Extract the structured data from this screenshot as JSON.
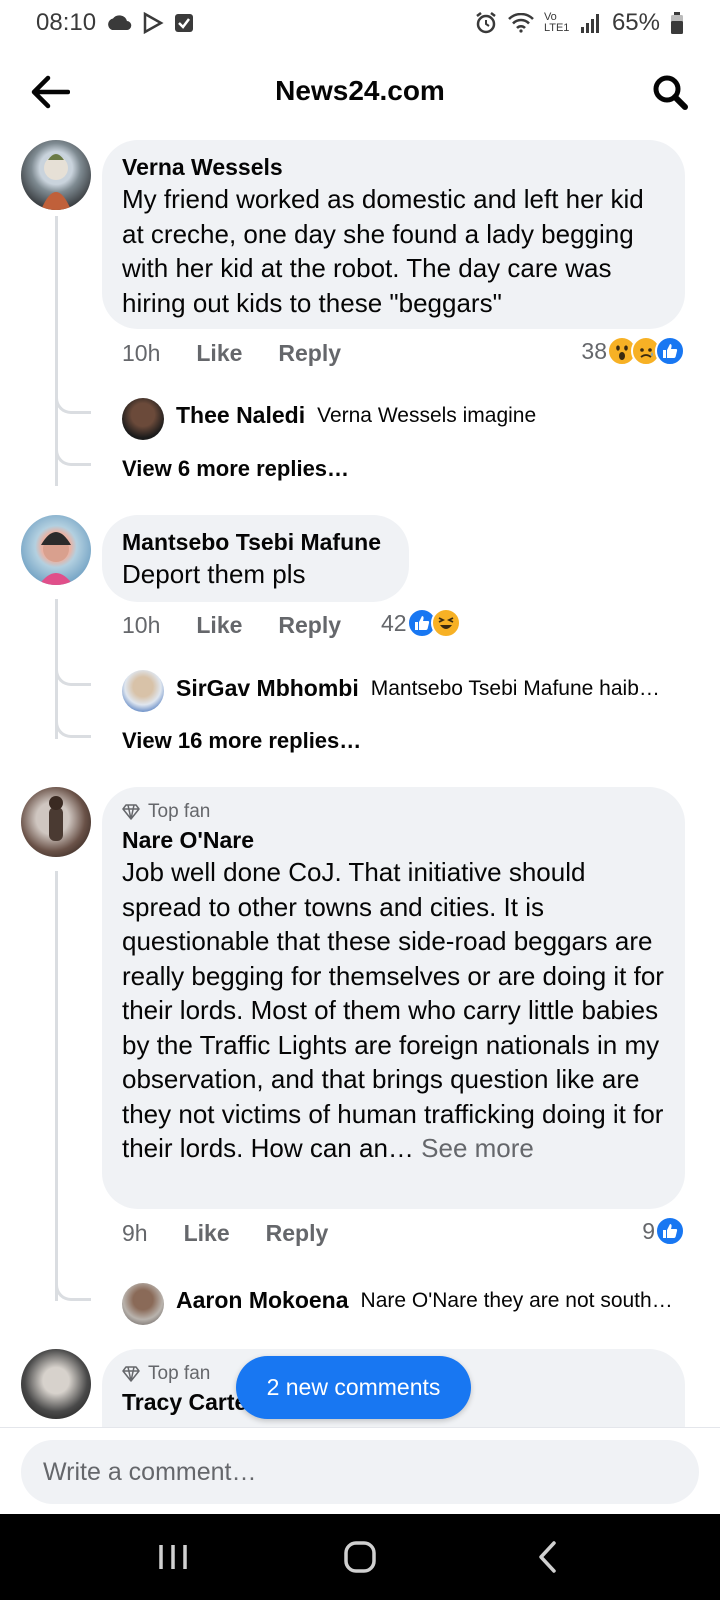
{
  "status_bar": {
    "time": "08:10",
    "battery": "65%",
    "network": "Vo LTE1"
  },
  "header": {
    "title": "News24.com"
  },
  "comments": [
    {
      "author": "Verna Wessels",
      "text": "My friend worked as domestic and left her kid at creche,  one day she found a lady begging with her kid at the robot. The day care was hiring out kids to these \"beggars\"",
      "time": "10h",
      "like_label": "Like",
      "reply_label": "Reply",
      "reaction_count": "38",
      "reactions": [
        "wow",
        "sad",
        "like"
      ],
      "reply": {
        "author": "Thee Naledi",
        "text": "Verna Wessels imagine"
      },
      "view_more": "View 6 more replies…"
    },
    {
      "author": "Mantsebo Tsebi Mafune",
      "text": "Deport them pls",
      "time": "10h",
      "like_label": "Like",
      "reply_label": "Reply",
      "reaction_count": "42",
      "reactions": [
        "like",
        "haha"
      ],
      "reply": {
        "author": "SirGav Mbhombi",
        "text": "Mantsebo Tsebi Mafune haib…"
      },
      "view_more": "View 16 more replies…"
    },
    {
      "badge": "Top fan",
      "author": "Nare O'Nare",
      "text": "Job well done CoJ. That initiative should spread to other towns and cities. It is questionable that these side-road beggars are really begging for themselves or are doing it for their lords.  Most of them who carry little babies by the Traffic Lights are foreign nationals in my observation, and that brings question like are they not victims of human trafficking doing it for their lords. How can an…",
      "see_more": "See more",
      "time": "9h",
      "like_label": "Like",
      "reply_label": "Reply",
      "reaction_count": "9",
      "reactions": [
        "like"
      ],
      "reply": {
        "author": "Aaron Mokoena",
        "text": "Nare O'Nare they are not south…"
      }
    },
    {
      "badge": "Top fan",
      "author": "Tracy Carter"
    }
  ],
  "new_comments_pill": "2 new comments",
  "composer": {
    "placeholder": "Write a comment…"
  },
  "colors": {
    "accent": "#1877f2",
    "bubble": "#f0f2f5",
    "secondary_text": "#65676b"
  }
}
